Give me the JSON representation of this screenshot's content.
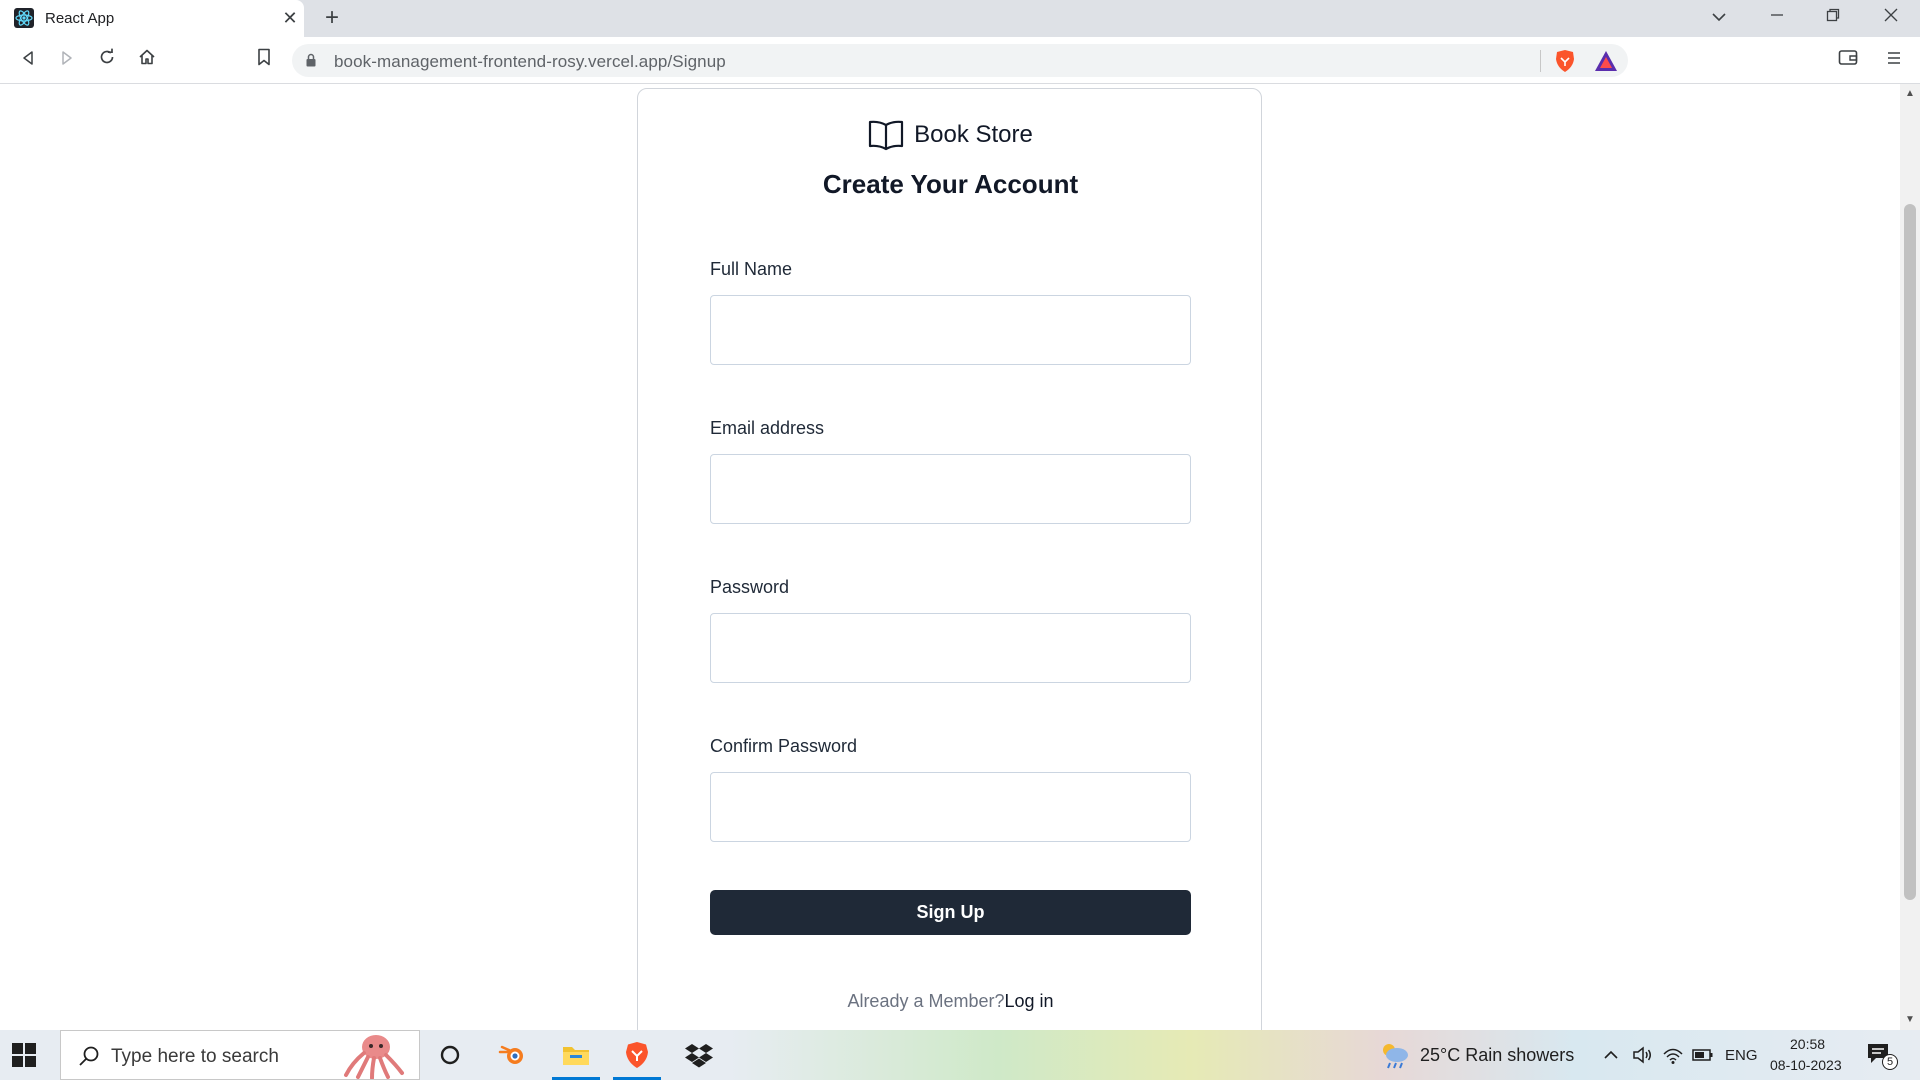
{
  "browser": {
    "tab_title": "React App",
    "url": "book-management-frontend-rosy.vercel.app/Signup"
  },
  "page": {
    "brand": "Book Store",
    "heading": "Create Your Account",
    "fields": [
      {
        "label": "Full Name",
        "value": "",
        "placeholder": ""
      },
      {
        "label": "Email address",
        "value": "",
        "placeholder": ""
      },
      {
        "label": "Password",
        "value": "",
        "placeholder": ""
      },
      {
        "label": "Confirm Password",
        "value": "",
        "placeholder": ""
      }
    ],
    "submit_label": "Sign Up",
    "member_text": "Already a Member?",
    "login_label": "Log in"
  },
  "taskbar": {
    "search_placeholder": "Type here to search",
    "weather": "25°C  Rain showers",
    "language": "ENG",
    "time": "20:58",
    "date": "08-10-2023",
    "notification_count": "5"
  },
  "colors": {
    "accent": "#1f2937",
    "card_border": "#d1d5db",
    "windows_blue": "#0078d4",
    "brave_orange": "#fb542b"
  }
}
